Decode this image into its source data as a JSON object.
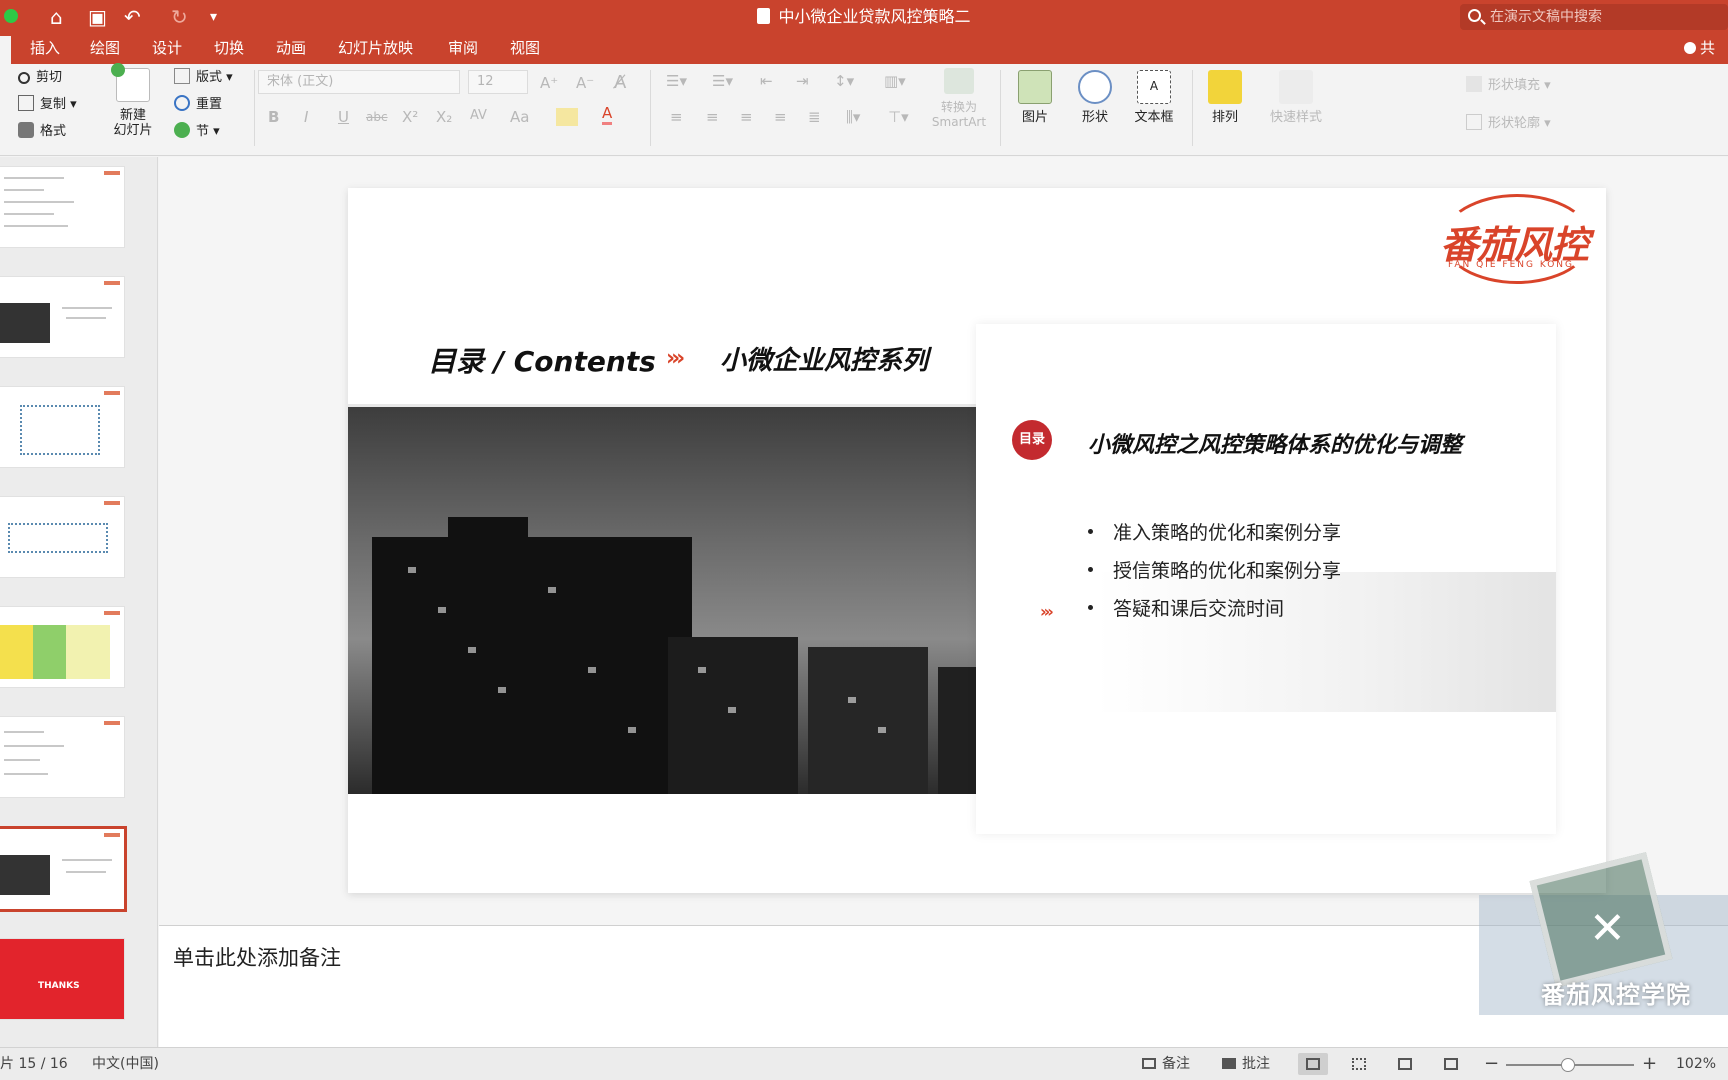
{
  "window": {
    "title": "中小微企业贷款风控策略二",
    "search_placeholder": "在演示文稿中搜索",
    "share_label": "共"
  },
  "quick_access": [
    "home-icon",
    "save-icon",
    "undo-icon",
    "redo-icon",
    "customize-icon"
  ],
  "ribbon_tabs": [
    "插入",
    "绘图",
    "设计",
    "切换",
    "动画",
    "幻灯片放映",
    "审阅",
    "视图"
  ],
  "ribbon": {
    "clipboard": {
      "cut": "剪切",
      "copy": "复制",
      "format": "格式"
    },
    "new_slide": "新建\n幻灯片",
    "slides": {
      "layout": "版式",
      "reset": "重置",
      "section": "节"
    },
    "font": {
      "name": "宋体 (正文)",
      "size": "12"
    },
    "format_glyphs": {
      "bold": "B",
      "italic": "I",
      "underline": "U",
      "strike": "abc",
      "superscript": "X²",
      "subscript": "X₂",
      "spacing": "AV",
      "case": "Aa",
      "font_color": "A"
    },
    "convert_smartart": "转换为\nSmartArt",
    "picture": "图片",
    "shape": "形状",
    "textbox": "文本框",
    "arrange": "排列",
    "quick_styles": "快速样式",
    "shape_fill": "形状填充",
    "shape_outline": "形状轮廓"
  },
  "thumbnails": {
    "last_thanks": "THANKS"
  },
  "slide": {
    "logo": {
      "text": "番茄风控",
      "sub": "FAN QIE FENG KONG"
    },
    "heading_left": "目录 / Contents",
    "heading_right": "小微企业风控系列",
    "badge": "目录",
    "panel_title": "小微风控之风控策略体系的优化与调整",
    "items": [
      "准入策略的优化和案例分享",
      "授信策略的优化和案例分享",
      "答疑和课后交流时间"
    ],
    "current_item_index": 2
  },
  "notes_placeholder": "单击此处添加备注",
  "watermark": "番茄风控学院",
  "status": {
    "slide_counter": "片 15 / 16",
    "language": "中文(中国)",
    "notes": "备注",
    "comments": "批注",
    "zoom": "102%"
  },
  "colors": {
    "accent": "#c9432d",
    "brand_red": "#d9442a",
    "badge_red": "#c32a2f"
  }
}
